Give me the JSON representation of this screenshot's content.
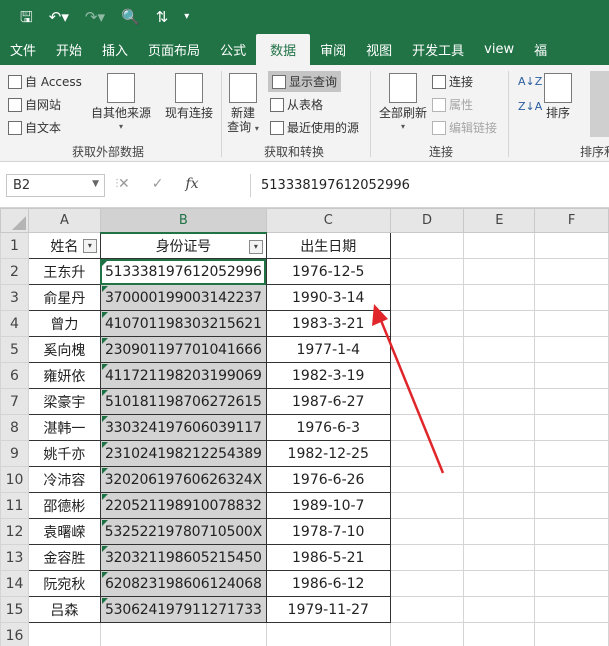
{
  "qat": {
    "save_icon": "save-icon",
    "undo_icon": "undo-icon",
    "redo_icon": "redo-icon",
    "print_preview_icon": "print-preview-icon",
    "sort_icon": "sort-icon",
    "customize_icon": "customize-qat-icon"
  },
  "tabs": [
    "文件",
    "开始",
    "插入",
    "页面布局",
    "公式",
    "数据",
    "审阅",
    "视图",
    "开发工具",
    "view",
    "福"
  ],
  "active_tab": "数据",
  "ribbon": {
    "get_external": {
      "from_access": "自 Access",
      "from_web": "自网站",
      "from_text": "自文本",
      "other_sources": "自其他来源",
      "existing_connections": "现有连接",
      "label": "获取外部数据"
    },
    "get_transform": {
      "new_query": "新建\n查询",
      "new_query_top": "新建",
      "new_query_bottom": "查询",
      "show_queries": "显示查询",
      "from_table": "从表格",
      "recent_sources": "最近使用的源",
      "label": "获取和转换"
    },
    "connections": {
      "refresh_all": "全部刷新",
      "connections": "连接",
      "properties": "属性",
      "edit_links": "编辑链接",
      "label": "连接"
    },
    "sort_filter": {
      "sort": "排序",
      "label": "排序和"
    }
  },
  "formula_bar": {
    "name_box": "B2",
    "cancel": "✕",
    "enter": "✓",
    "fx": "fx",
    "value": "513338197612052996"
  },
  "columns": [
    "A",
    "B",
    "C",
    "D",
    "E",
    "F"
  ],
  "headers": {
    "name": "姓名",
    "id": "身份证号",
    "birth": "出生日期"
  },
  "rows": [
    {
      "n": "2",
      "name": "王东升",
      "id": "513338197612052996",
      "birth": "1976-12-5"
    },
    {
      "n": "3",
      "name": "俞星丹",
      "id": "370000199003142237",
      "birth": "1990-3-14"
    },
    {
      "n": "4",
      "name": "曾力",
      "id": "410701198303215621",
      "birth": "1983-3-21"
    },
    {
      "n": "5",
      "name": "奚向槐",
      "id": "230901197701041666",
      "birth": "1977-1-4"
    },
    {
      "n": "6",
      "name": "雍妍依",
      "id": "411721198203199069",
      "birth": "1982-3-19"
    },
    {
      "n": "7",
      "name": "梁豪宇",
      "id": "510181198706272615",
      "birth": "1987-6-27"
    },
    {
      "n": "8",
      "name": "湛韩一",
      "id": "330324197606039117",
      "birth": "1976-6-3"
    },
    {
      "n": "9",
      "name": "姚千亦",
      "id": "231024198212254389",
      "birth": "1982-12-25"
    },
    {
      "n": "10",
      "name": "冷沛容",
      "id": "32020619760626324X",
      "birth": "1976-6-26"
    },
    {
      "n": "11",
      "name": "邵德彬",
      "id": "220521198910078832",
      "birth": "1989-10-7"
    },
    {
      "n": "12",
      "name": "袁曙嵘",
      "id": "53252219780710500X",
      "birth": "1978-7-10"
    },
    {
      "n": "13",
      "name": "金容胜",
      "id": "320321198605215450",
      "birth": "1986-5-21"
    },
    {
      "n": "14",
      "name": "阮宛秋",
      "id": "620823198606124068",
      "birth": "1986-6-12"
    },
    {
      "n": "15",
      "name": "吕森",
      "id": "530624197911271733",
      "birth": "1979-11-27"
    }
  ],
  "extra_rows": [
    "1",
    "16"
  ],
  "colors": {
    "excel_green": "#217346",
    "selection_gray": "#d3d3d3",
    "arrow_red": "#e0262a"
  }
}
